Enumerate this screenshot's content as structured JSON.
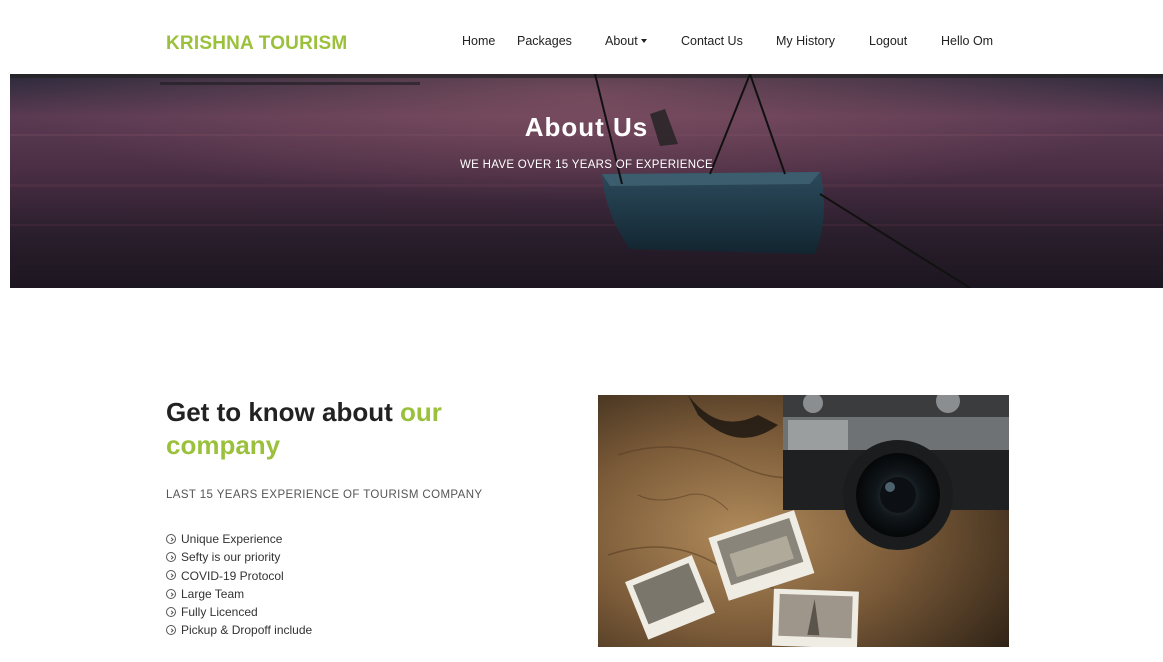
{
  "nav": {
    "brand": "KRISHNA TOURISM",
    "items": [
      {
        "label": "Home"
      },
      {
        "label": "Packages"
      },
      {
        "label": "About"
      },
      {
        "label": "Contact Us"
      },
      {
        "label": "My History"
      },
      {
        "label": "Logout"
      },
      {
        "label": "Hello Om"
      }
    ]
  },
  "hero": {
    "title": "About Us",
    "subtitle": "WE HAVE OVER 15 YEARS OF EXPERIENCE"
  },
  "about": {
    "title_plain": "Get to know about ",
    "title_accent": "our company",
    "subtitle": "LAST 15 YEARS EXPERIENCE OF TOURISM COMPANY",
    "features": [
      "Unique Experience",
      "Sefty is our priority",
      "COVID-19 Protocol",
      "Large Team",
      "Fully Licenced",
      "Pickup & Dropoff include"
    ]
  },
  "colors": {
    "accent": "#9bc13c",
    "text": "#222222"
  }
}
